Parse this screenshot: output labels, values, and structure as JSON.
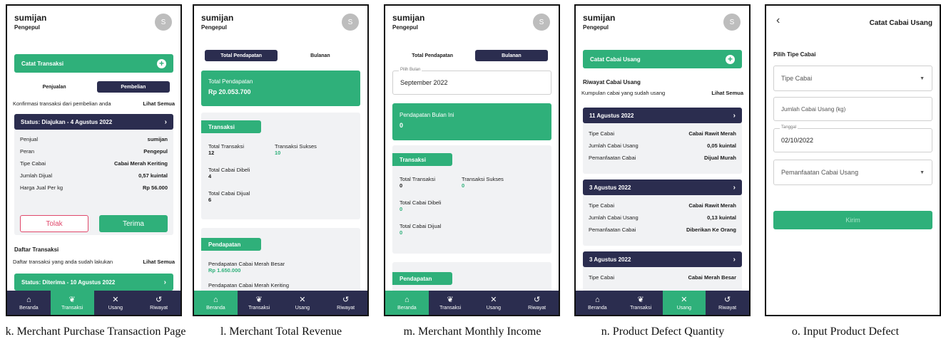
{
  "common": {
    "user_name": "sumijan",
    "user_role": "Pengepul",
    "avatar_initial": "S",
    "nav": [
      "Beranda",
      "Transaksi",
      "Usang",
      "Riwayat"
    ]
  },
  "colors": {
    "green": "#2fb07a",
    "navy": "#2b2d4f",
    "red_outline": "#e0486b"
  },
  "screen_k": {
    "caption": "k. Merchant Purchase Transaction Page",
    "catat_btn": "Catat Transaksi",
    "seg": [
      "Penjualan",
      "Pembelian"
    ],
    "confirm_text": "Konfirmasi transaksi dari pembelian anda",
    "see_all": "Lihat Semua",
    "status_title": "Status: Diajukan - 4 Agustus 2022",
    "rows": [
      {
        "k": "Penjual",
        "v": "sumijan"
      },
      {
        "k": "Peran",
        "v": "Pengepul"
      },
      {
        "k": "Tipe Cabai",
        "v": "Cabai Merah Keriting"
      },
      {
        "k": "Jumlah Dijual",
        "v": "0,57 kuintal"
      },
      {
        "k": "Harga Jual Per kg",
        "v": "Rp 56.000"
      }
    ],
    "reject": "Tolak",
    "accept": "Terima",
    "list_title": "Daftar Transaksi",
    "list_text": "Daftar transaksi yang anda sudah lakukan",
    "status2": "Status: Diterima - 10 Agustus 2022"
  },
  "screen_l": {
    "caption": "l. Merchant Total Revenue",
    "seg": [
      "Total Pendapatan",
      "Bulanan"
    ],
    "total_label": "Total Pendapatan",
    "total_value": "Rp 20.053.700",
    "tx_tab": "Transaksi",
    "total_tx_label": "Total Transaksi",
    "total_tx": "12",
    "success_label": "Transaksi Sukses",
    "success": "10",
    "bought_label": "Total Cabai Dibeli",
    "bought": "4",
    "sold_label": "Total Cabai Dijual",
    "sold": "6",
    "income_tab": "Pendapatan",
    "income1_label": "Pendapatan Cabai Merah Besar",
    "income1": "Rp 1.650.000",
    "income2_label": "Pendapatan Cabai Merah Keriting"
  },
  "screen_m": {
    "caption": "m. Merchant Monthly Income",
    "seg": [
      "Total Pendapatan",
      "Bulanan"
    ],
    "month_label": "Pilih Bulan",
    "month_value": "September 2022",
    "month_income_label": "Pendapatan Bulan Ini",
    "month_income": "0",
    "tx_tab": "Transaksi",
    "total_tx_label": "Total Transaksi",
    "total_tx": "0",
    "success_label": "Transaksi Sukses",
    "success": "0",
    "bought_label": "Total Cabai Dibeli",
    "bought": "0",
    "sold_label": "Total Cabai Dijual",
    "sold": "0",
    "income_tab": "Pendapatan"
  },
  "screen_n": {
    "caption": "n. Product Defect Quantity",
    "catat_btn": "Catat Cabai Usang",
    "history_title": "Riwayat Cabai Usang",
    "history_text": "Kumpulan cabai yang sudah usang",
    "see_all": "Lihat Semua",
    "records": [
      {
        "date": "11 Agustus 2022",
        "rows": [
          {
            "k": "Tipe Cabai",
            "v": "Cabai Rawit Merah"
          },
          {
            "k": "Jumlah Cabai Usang",
            "v": "0,05 kuintal"
          },
          {
            "k": "Pemanfaatan Cabai",
            "v": "Dijual Murah"
          }
        ]
      },
      {
        "date": "3 Agustus 2022",
        "rows": [
          {
            "k": "Tipe Cabai",
            "v": "Cabai Rawit Merah"
          },
          {
            "k": "Jumlah Cabai Usang",
            "v": "0,13 kuintal"
          },
          {
            "k": "Pemanfaatan Cabai",
            "v": "Diberikan Ke Orang"
          }
        ]
      },
      {
        "date": "3 Agustus 2022",
        "rows": [
          {
            "k": "Tipe Cabai",
            "v": "Cabai Merah Besar"
          }
        ]
      }
    ]
  },
  "screen_o": {
    "caption": "o. Input Product Defect",
    "title": "Catat Cabai Usang",
    "section": "Pilih Tipe Cabai",
    "type_placeholder": "Tipe Cabai",
    "qty_placeholder": "Jumlah Cabai Usang (kg)",
    "date_label": "Tanggal",
    "date_value": "02/10/2022",
    "use_placeholder": "Pemanfaatan Cabai Usang",
    "submit": "Kirim"
  }
}
